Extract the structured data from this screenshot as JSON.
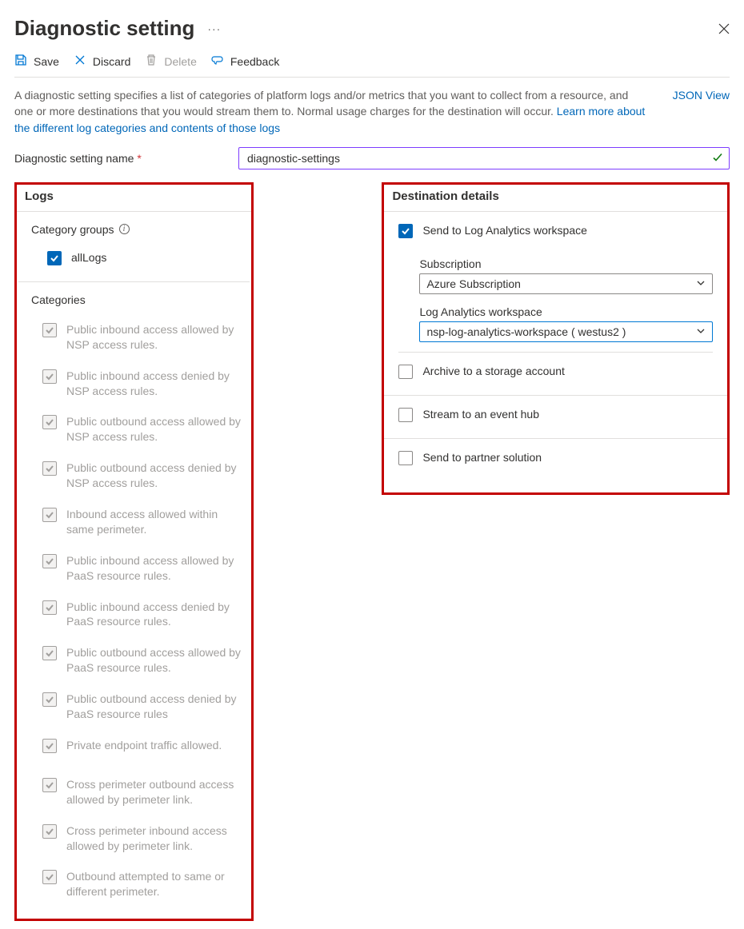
{
  "header": {
    "title": "Diagnostic setting",
    "more": "···"
  },
  "toolbar": {
    "save": "Save",
    "discard": "Discard",
    "delete": "Delete",
    "feedback": "Feedback"
  },
  "intro": {
    "text": "A diagnostic setting specifies a list of categories of platform logs and/or metrics that you want to collect from a resource, and one or more destinations that you would stream them to. Normal usage charges for the destination will occur. ",
    "link_text": "Learn more about the different log categories and contents of those logs",
    "json_view": "JSON View"
  },
  "name": {
    "label": "Diagnostic setting name",
    "required_marker": "*",
    "value": "diagnostic-settings"
  },
  "logs": {
    "title": "Logs",
    "groups_label": "Category groups",
    "groups": [
      {
        "label": "allLogs",
        "checked": true,
        "disabled": false
      }
    ],
    "categories_label": "Categories",
    "categories": [
      {
        "label": "Public inbound access allowed by NSP access rules.",
        "checked": true,
        "disabled": true
      },
      {
        "label": "Public inbound access denied by NSP access rules.",
        "checked": true,
        "disabled": true
      },
      {
        "label": "Public outbound access allowed by NSP access rules.",
        "checked": true,
        "disabled": true
      },
      {
        "label": "Public outbound access denied by NSP access rules.",
        "checked": true,
        "disabled": true
      },
      {
        "label": "Inbound access allowed within same perimeter.",
        "checked": true,
        "disabled": true
      },
      {
        "label": "Public inbound access allowed by PaaS resource rules.",
        "checked": true,
        "disabled": true
      },
      {
        "label": "Public inbound access denied by PaaS resource rules.",
        "checked": true,
        "disabled": true
      },
      {
        "label": "Public outbound access allowed by PaaS resource rules.",
        "checked": true,
        "disabled": true
      },
      {
        "label": "Public outbound access denied by PaaS resource rules",
        "checked": true,
        "disabled": true
      },
      {
        "label": "Private endpoint traffic allowed.",
        "checked": true,
        "disabled": true
      },
      {
        "label": "Cross perimeter outbound access allowed by perimeter link.",
        "checked": true,
        "disabled": true,
        "extra_gap": true
      },
      {
        "label": "Cross perimeter inbound access allowed by perimeter link.",
        "checked": true,
        "disabled": true
      },
      {
        "label": "Outbound attempted to same or different perimeter.",
        "checked": true,
        "disabled": true
      }
    ]
  },
  "dest": {
    "title": "Destination details",
    "log_analytics": {
      "label": "Send to Log Analytics workspace",
      "checked": true,
      "sub": {
        "subscription_label": "Subscription",
        "subscription_value": "Azure Subscription",
        "workspace_label": "Log Analytics workspace",
        "workspace_value": "nsp-log-analytics-workspace ( westus2 )"
      }
    },
    "storage": {
      "label": "Archive to a storage account",
      "checked": false
    },
    "eventhub": {
      "label": "Stream to an event hub",
      "checked": false
    },
    "partner": {
      "label": "Send to partner solution",
      "checked": false
    }
  }
}
